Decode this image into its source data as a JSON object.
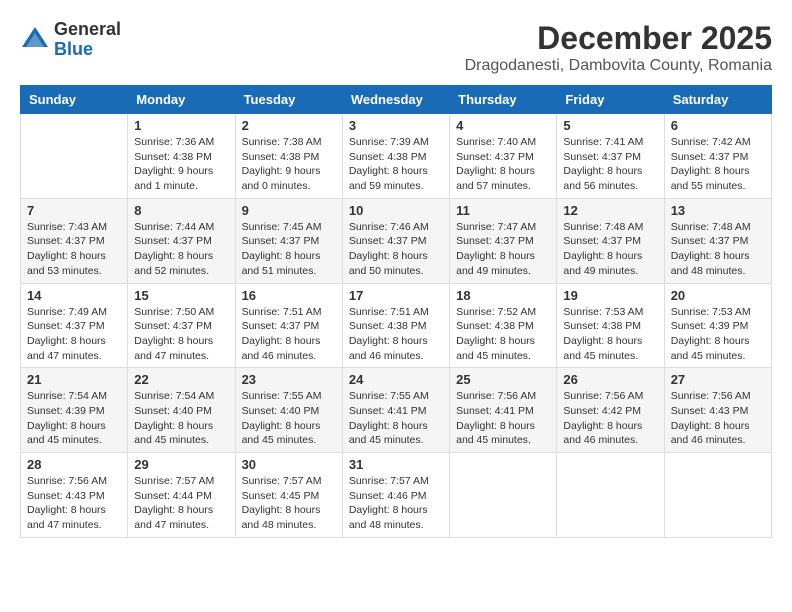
{
  "logo": {
    "general": "General",
    "blue": "Blue"
  },
  "title": "December 2025",
  "location": "Dragodanesti, Dambovita County, Romania",
  "weekdays": [
    "Sunday",
    "Monday",
    "Tuesday",
    "Wednesday",
    "Thursday",
    "Friday",
    "Saturday"
  ],
  "weeks": [
    [
      {
        "day": "",
        "info": ""
      },
      {
        "day": "1",
        "info": "Sunrise: 7:36 AM\nSunset: 4:38 PM\nDaylight: 9 hours\nand 1 minute."
      },
      {
        "day": "2",
        "info": "Sunrise: 7:38 AM\nSunset: 4:38 PM\nDaylight: 9 hours\nand 0 minutes."
      },
      {
        "day": "3",
        "info": "Sunrise: 7:39 AM\nSunset: 4:38 PM\nDaylight: 8 hours\nand 59 minutes."
      },
      {
        "day": "4",
        "info": "Sunrise: 7:40 AM\nSunset: 4:37 PM\nDaylight: 8 hours\nand 57 minutes."
      },
      {
        "day": "5",
        "info": "Sunrise: 7:41 AM\nSunset: 4:37 PM\nDaylight: 8 hours\nand 56 minutes."
      },
      {
        "day": "6",
        "info": "Sunrise: 7:42 AM\nSunset: 4:37 PM\nDaylight: 8 hours\nand 55 minutes."
      }
    ],
    [
      {
        "day": "7",
        "info": "Sunrise: 7:43 AM\nSunset: 4:37 PM\nDaylight: 8 hours\nand 53 minutes."
      },
      {
        "day": "8",
        "info": "Sunrise: 7:44 AM\nSunset: 4:37 PM\nDaylight: 8 hours\nand 52 minutes."
      },
      {
        "day": "9",
        "info": "Sunrise: 7:45 AM\nSunset: 4:37 PM\nDaylight: 8 hours\nand 51 minutes."
      },
      {
        "day": "10",
        "info": "Sunrise: 7:46 AM\nSunset: 4:37 PM\nDaylight: 8 hours\nand 50 minutes."
      },
      {
        "day": "11",
        "info": "Sunrise: 7:47 AM\nSunset: 4:37 PM\nDaylight: 8 hours\nand 49 minutes."
      },
      {
        "day": "12",
        "info": "Sunrise: 7:48 AM\nSunset: 4:37 PM\nDaylight: 8 hours\nand 49 minutes."
      },
      {
        "day": "13",
        "info": "Sunrise: 7:48 AM\nSunset: 4:37 PM\nDaylight: 8 hours\nand 48 minutes."
      }
    ],
    [
      {
        "day": "14",
        "info": "Sunrise: 7:49 AM\nSunset: 4:37 PM\nDaylight: 8 hours\nand 47 minutes."
      },
      {
        "day": "15",
        "info": "Sunrise: 7:50 AM\nSunset: 4:37 PM\nDaylight: 8 hours\nand 47 minutes."
      },
      {
        "day": "16",
        "info": "Sunrise: 7:51 AM\nSunset: 4:37 PM\nDaylight: 8 hours\nand 46 minutes."
      },
      {
        "day": "17",
        "info": "Sunrise: 7:51 AM\nSunset: 4:38 PM\nDaylight: 8 hours\nand 46 minutes."
      },
      {
        "day": "18",
        "info": "Sunrise: 7:52 AM\nSunset: 4:38 PM\nDaylight: 8 hours\nand 45 minutes."
      },
      {
        "day": "19",
        "info": "Sunrise: 7:53 AM\nSunset: 4:38 PM\nDaylight: 8 hours\nand 45 minutes."
      },
      {
        "day": "20",
        "info": "Sunrise: 7:53 AM\nSunset: 4:39 PM\nDaylight: 8 hours\nand 45 minutes."
      }
    ],
    [
      {
        "day": "21",
        "info": "Sunrise: 7:54 AM\nSunset: 4:39 PM\nDaylight: 8 hours\nand 45 minutes."
      },
      {
        "day": "22",
        "info": "Sunrise: 7:54 AM\nSunset: 4:40 PM\nDaylight: 8 hours\nand 45 minutes."
      },
      {
        "day": "23",
        "info": "Sunrise: 7:55 AM\nSunset: 4:40 PM\nDaylight: 8 hours\nand 45 minutes."
      },
      {
        "day": "24",
        "info": "Sunrise: 7:55 AM\nSunset: 4:41 PM\nDaylight: 8 hours\nand 45 minutes."
      },
      {
        "day": "25",
        "info": "Sunrise: 7:56 AM\nSunset: 4:41 PM\nDaylight: 8 hours\nand 45 minutes."
      },
      {
        "day": "26",
        "info": "Sunrise: 7:56 AM\nSunset: 4:42 PM\nDaylight: 8 hours\nand 46 minutes."
      },
      {
        "day": "27",
        "info": "Sunrise: 7:56 AM\nSunset: 4:43 PM\nDaylight: 8 hours\nand 46 minutes."
      }
    ],
    [
      {
        "day": "28",
        "info": "Sunrise: 7:56 AM\nSunset: 4:43 PM\nDaylight: 8 hours\nand 47 minutes."
      },
      {
        "day": "29",
        "info": "Sunrise: 7:57 AM\nSunset: 4:44 PM\nDaylight: 8 hours\nand 47 minutes."
      },
      {
        "day": "30",
        "info": "Sunrise: 7:57 AM\nSunset: 4:45 PM\nDaylight: 8 hours\nand 48 minutes."
      },
      {
        "day": "31",
        "info": "Sunrise: 7:57 AM\nSunset: 4:46 PM\nDaylight: 8 hours\nand 48 minutes."
      },
      {
        "day": "",
        "info": ""
      },
      {
        "day": "",
        "info": ""
      },
      {
        "day": "",
        "info": ""
      }
    ]
  ]
}
